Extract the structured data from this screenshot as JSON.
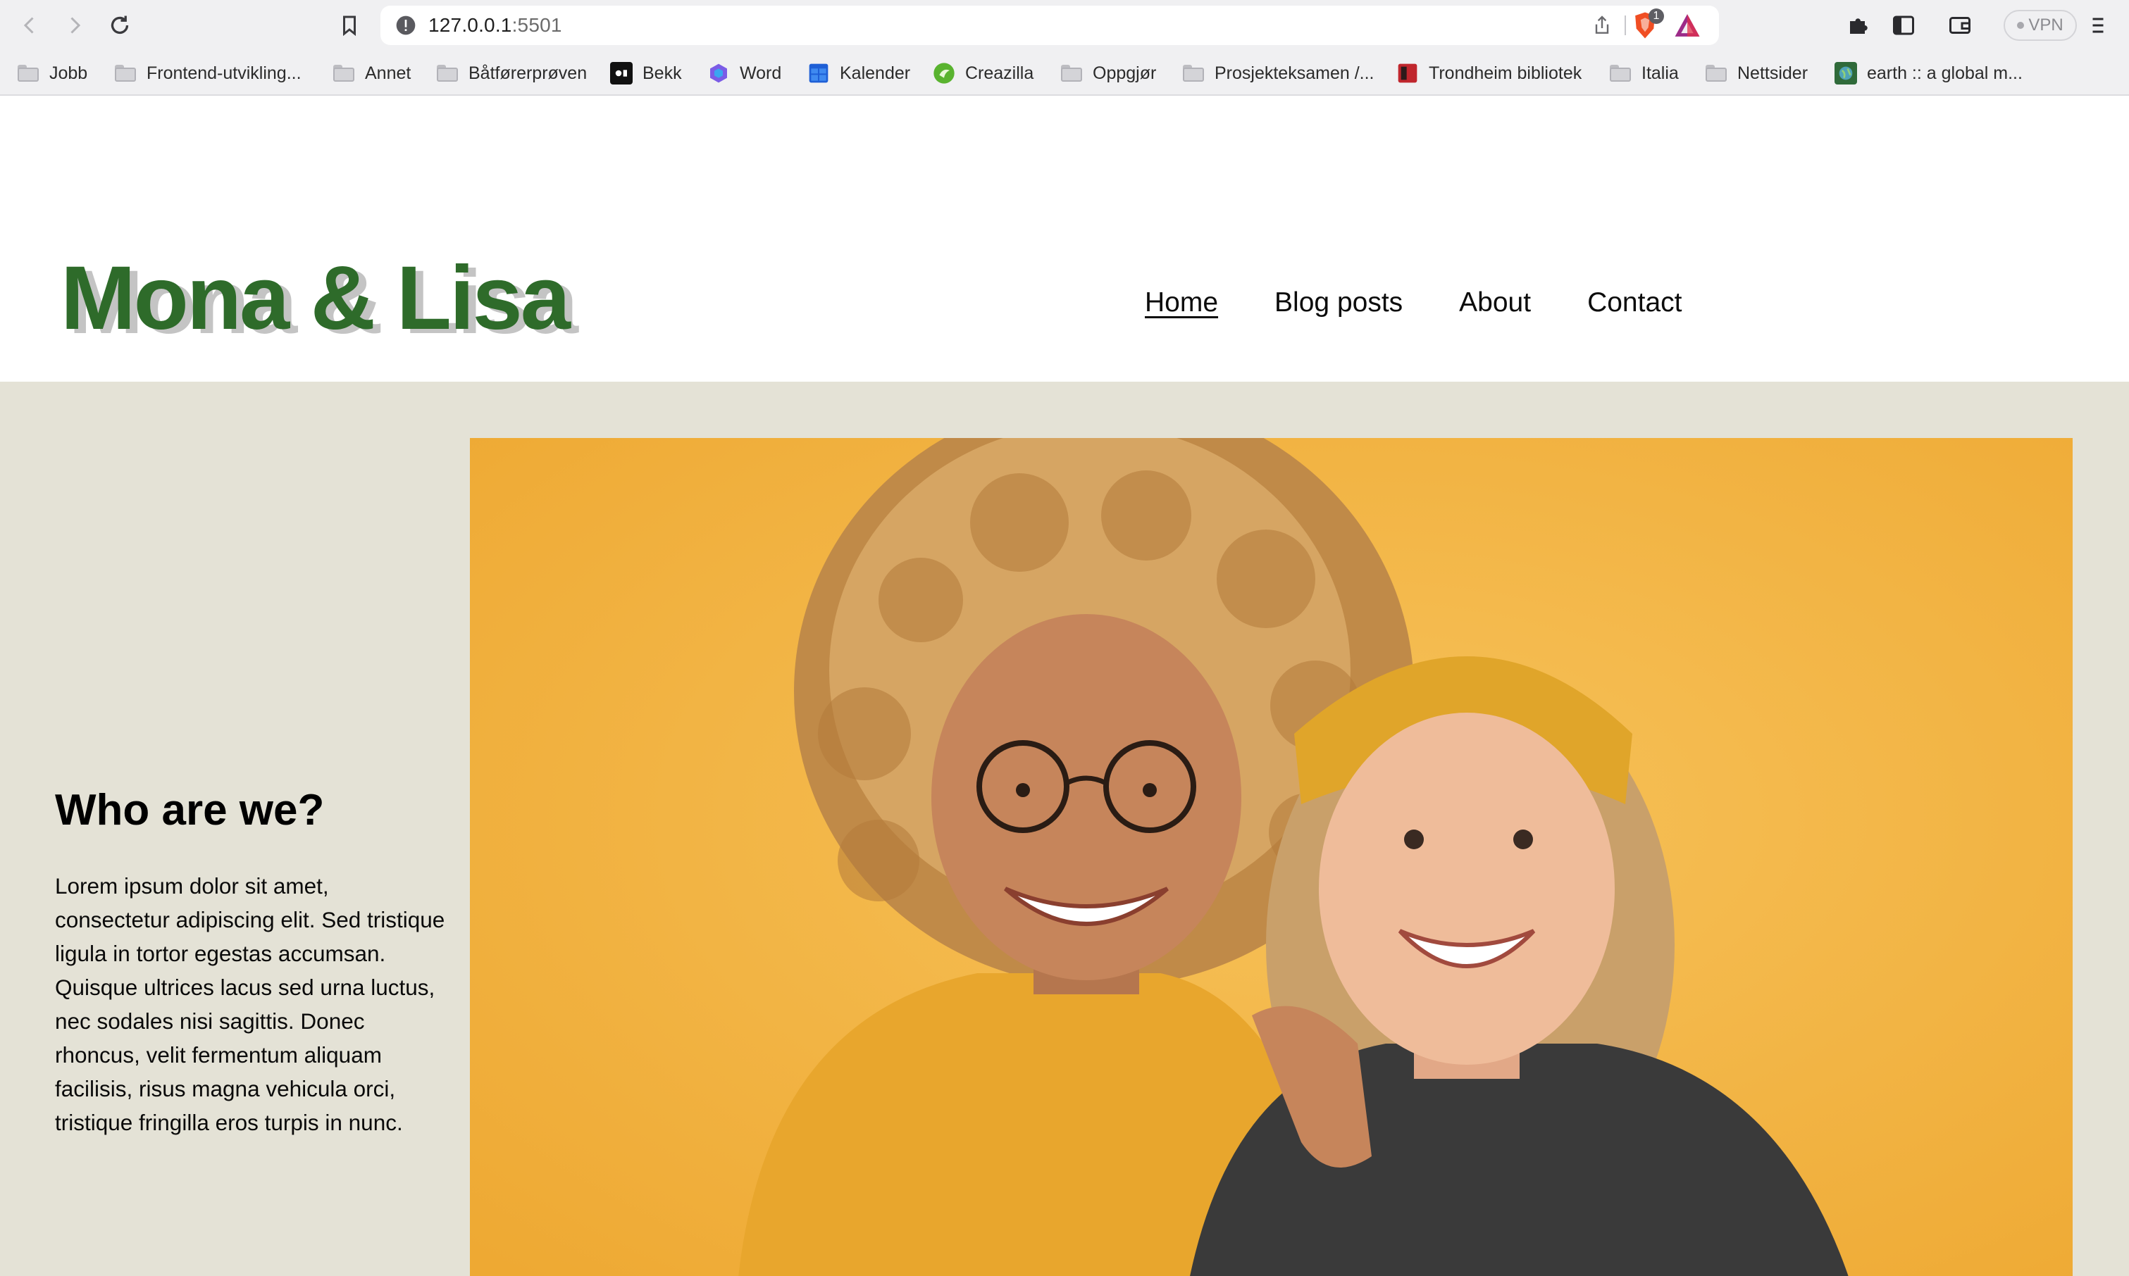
{
  "browser": {
    "url_host": "127.0.0.1",
    "url_port": ":5501",
    "shield_count": "1",
    "vpn_label": "VPN"
  },
  "bookmarks": [
    {
      "label": "Jobb",
      "icon": "folder-icon"
    },
    {
      "label": "Frontend-utvikling...",
      "icon": "folder-icon"
    },
    {
      "label": "Annet",
      "icon": "folder-icon"
    },
    {
      "label": "Båtførerprøven",
      "icon": "folder-icon"
    },
    {
      "label": "Bekk",
      "icon": "bekk-icon"
    },
    {
      "label": "Word",
      "icon": "word-icon"
    },
    {
      "label": "Kalender",
      "icon": "calendar-icon"
    },
    {
      "label": "Creazilla",
      "icon": "creazilla-icon"
    },
    {
      "label": "Oppgjør",
      "icon": "folder-icon"
    },
    {
      "label": "Prosjekteksamen /...",
      "icon": "folder-icon"
    },
    {
      "label": "Trondheim bibliotek",
      "icon": "library-icon"
    },
    {
      "label": "Italia",
      "icon": "folder-icon"
    },
    {
      "label": "Nettsider",
      "icon": "folder-icon"
    },
    {
      "label": "earth :: a global m...",
      "icon": "earth-icon"
    }
  ],
  "site": {
    "logo": "Mona & Lisa",
    "nav": [
      "Home",
      "Blog posts",
      "About",
      "Contact"
    ],
    "active_nav": "Home",
    "hero": {
      "title": "Who are we?",
      "text": "Lorem ipsum dolor sit amet, consectetur adipiscing elit. Sed tristique ligula in tortor egestas accumsan. Quisque ultrices lacus sed urna luctus, nec sodales nisi sagittis. Donec rhoncus, velit fermentum aliquam facilisis, risus magna vehicula orci, tristique fringilla eros turpis in nunc."
    }
  },
  "colors": {
    "brand_green": "#2e6b2a",
    "hero_background": "#e4e2d6",
    "photo_background": "#f0b13f"
  }
}
